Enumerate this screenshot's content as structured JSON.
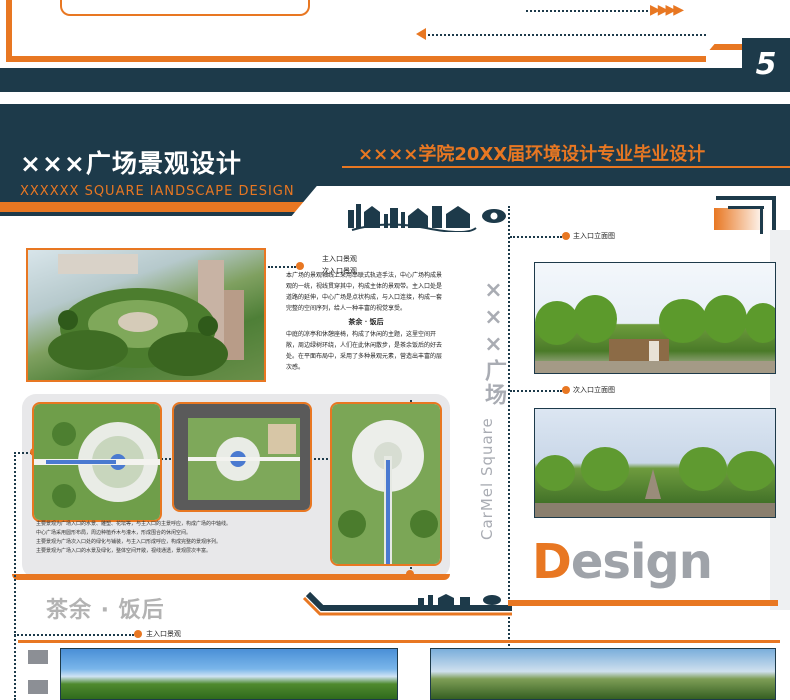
{
  "page": {
    "number": "5"
  },
  "header": {
    "title_cn": "×××广场景观设计",
    "title_en": "XXXXXX SQUARE lANDSCAPE DESIGN",
    "school": "××××学院20XX届环境设计专业毕业设计"
  },
  "labels": {
    "main_entrance_view": "主入口景观",
    "secondary_entrance_view": "次入口景观",
    "main_entrance_elevation": "主入口立面图",
    "secondary_entrance_elevation": "次入口立面图",
    "bottom_main_entrance": "主入口景观"
  },
  "text_block": {
    "para1": "本广场的景观轴线上采用串联式轨迹手法，中心广场构成景观的一统，视线贯穿其中，构成主体的景观带。主入口处是道路的延伸，中心广场是点状构成，与入口连接，构成一套完整的空间序列，给人一种丰富的视觉享受。",
    "heading": "茶余 · 饭后",
    "para2": "中庭的凉亭和休憩座椅，构成了休闲的主题，这里空间开敞，周边绿树环绕，人们在此休闲散步，是茶余饭后的好去处。在平面布局中，采用了多种景观元素，营造出丰富的层次感。"
  },
  "plan_text": {
    "line1": "主要景观为广场入口的水景、雕塑、花坛等，与主入口的主景呼应，构成广场的中轴线。",
    "line2": "中心广场采用圆形布局，周边种植乔木与灌木，形成围合的休闲空间。",
    "line3": "主要景观为广场次入口处的绿化与铺装，与主入口形成呼应，构成完整的景观序列。",
    "line4": "主要景观为广场入口的水景及绿化，整体空间开敞，视线通透，景观层次丰富。"
  },
  "branding": {
    "vertical_cn": "×××广场",
    "vertical_en": "CarMel Square",
    "design_initial": "D",
    "design_rest": "esign"
  },
  "slogan": "茶余 · 饭后",
  "colors": {
    "navy": "#1d3a4a",
    "orange": "#e87722",
    "gray": "#9fa3a9"
  },
  "icons": [
    "city-skyline-icon",
    "eye-icon",
    "arrow-left-icon",
    "chevron-right-icon"
  ]
}
